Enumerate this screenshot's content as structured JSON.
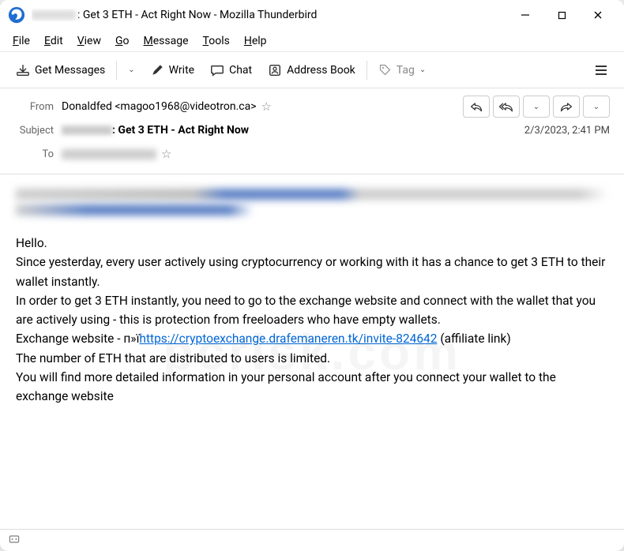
{
  "window": {
    "title_suffix": ": Get 3 ETH - Act Right Now - Mozilla Thunderbird"
  },
  "menu": {
    "file": "File",
    "edit": "Edit",
    "view": "View",
    "go": "Go",
    "message": "Message",
    "tools": "Tools",
    "help": "Help"
  },
  "toolbar": {
    "get_messages": "Get Messages",
    "write": "Write",
    "chat": "Chat",
    "address_book": "Address Book",
    "tag": "Tag"
  },
  "headers": {
    "from_label": "From",
    "from_value": "Donaldfed <magoo1968@videotron.ca>",
    "subject_label": "Subject",
    "subject_value": ": Get 3 ETH - Act Right Now",
    "to_label": "To",
    "date": "2/3/2023, 2:41 PM"
  },
  "body": {
    "greeting": "Hello.",
    "p1": "Since yesterday, every user actively using cryptocurrency or working with it has a chance to get 3 ETH to their wallet instantly.",
    "p2": "In order to get 3 ETH instantly, you need to go to the exchange website and connect with the wallet that you are actively using - this is protection from freeloaders who have empty wallets.",
    "link_prefix": "Exchange website - п»ї",
    "link_text": "https://cryptoexchange.drafemaneren.tk/invite-824642",
    "link_suffix": " (affiliate link)",
    "p3": "The number of ETH that are distributed to users is limited.",
    "p4": "You will find more detailed information in your personal account after you connect your wallet to the exchange website"
  },
  "watermark": "pcrisk.com"
}
